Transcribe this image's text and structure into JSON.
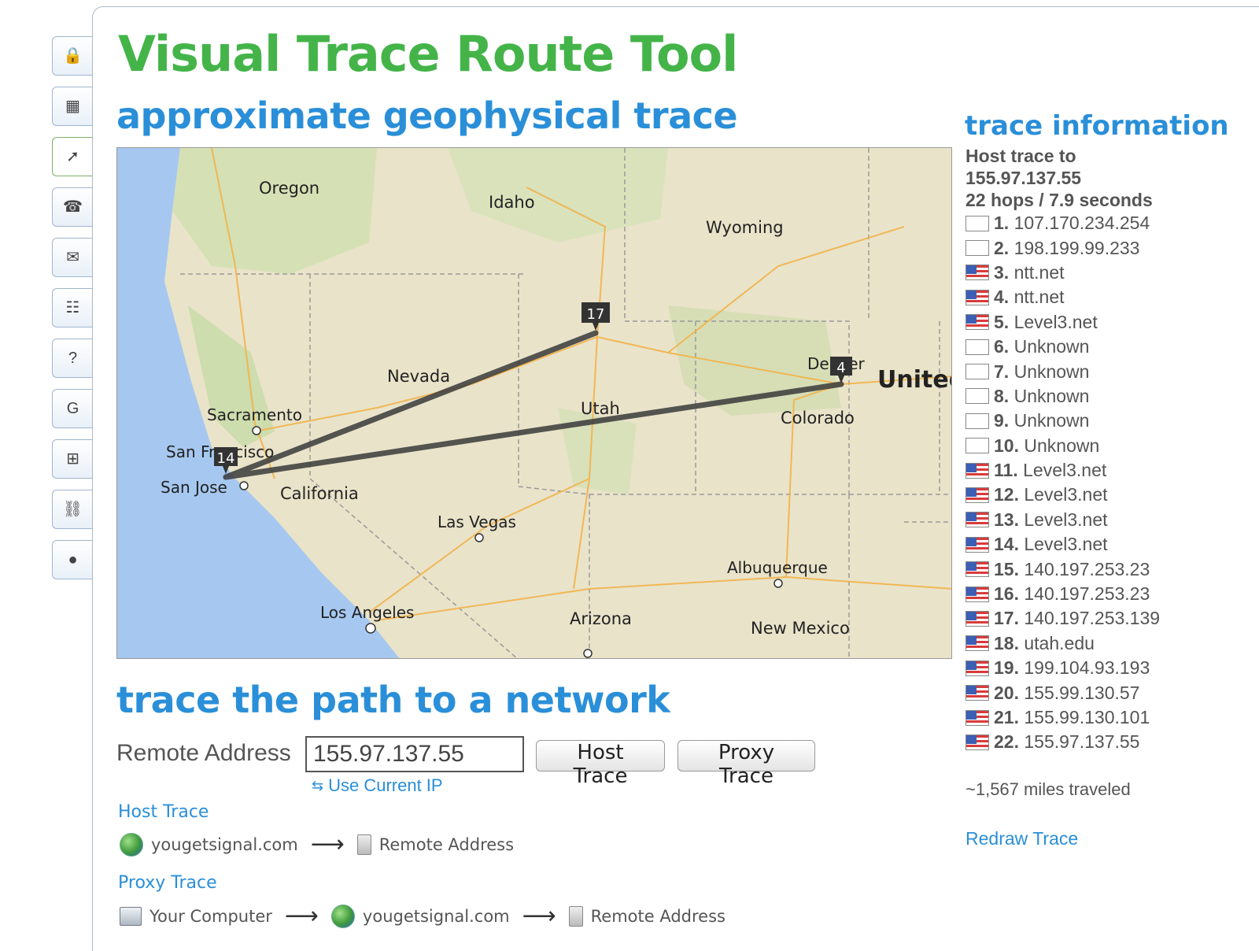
{
  "header": {
    "title": "Visual Trace Route Tool",
    "subtitle": "approximate geophysical trace"
  },
  "toolbar": {
    "items": [
      {
        "icon": "lock-icon",
        "glyph": "🔒"
      },
      {
        "icon": "map-icon",
        "glyph": "▦"
      },
      {
        "icon": "map-trace-icon",
        "glyph": "➚"
      },
      {
        "icon": "phone-icon",
        "glyph": "☎"
      },
      {
        "icon": "mail-icon",
        "glyph": "✉"
      },
      {
        "icon": "network-icon",
        "glyph": "☷"
      },
      {
        "icon": "help-icon",
        "glyph": "?"
      },
      {
        "icon": "google-icon",
        "glyph": "G"
      },
      {
        "icon": "windows-icon",
        "glyph": "⊞"
      },
      {
        "icon": "link-icon",
        "glyph": "⛓"
      },
      {
        "icon": "globe-icon",
        "glyph": "●"
      }
    ]
  },
  "map": {
    "states": [
      "Oregon",
      "Idaho",
      "Wyoming",
      "Nevada",
      "Utah",
      "Colorado",
      "California",
      "Arizona",
      "New Mexico"
    ],
    "cities": [
      "Sacramento",
      "San Francisco",
      "San Jose",
      "Las Vegas",
      "Los Angeles",
      "Albuquerque",
      "Denver"
    ],
    "country_label": "United",
    "markers": [
      "14",
      "17",
      "4"
    ]
  },
  "form": {
    "heading": "trace the path to a network",
    "remote_label": "Remote Address",
    "remote_value": "155.97.137.55",
    "host_trace_button": "Host Trace",
    "proxy_trace_button": "Proxy Trace",
    "use_current_ip": "Use Current IP"
  },
  "diagrams": {
    "host_title": "Host Trace",
    "proxy_title": "Proxy Trace",
    "site": "yougetsignal.com",
    "remote": "Remote Address",
    "your_computer": "Your Computer"
  },
  "trace_info": {
    "title": "trace information",
    "summary_line1": "Host trace to",
    "summary_line2": "155.97.137.55",
    "summary_line3": "22 hops / 7.9 seconds",
    "hops": [
      {
        "num": "1.",
        "host": " 107.170.234.254",
        "flag": "blank"
      },
      {
        "num": "2.",
        "host": " 198.199.99.233",
        "flag": "blank"
      },
      {
        "num": "3.",
        "host": " ntt.net",
        "flag": "us"
      },
      {
        "num": "4.",
        "host": " ntt.net",
        "flag": "us"
      },
      {
        "num": "5.",
        "host": " Level3.net",
        "flag": "us"
      },
      {
        "num": "6.",
        "host": " Unknown",
        "flag": "blank"
      },
      {
        "num": "7.",
        "host": " Unknown",
        "flag": "blank"
      },
      {
        "num": "8.",
        "host": " Unknown",
        "flag": "blank"
      },
      {
        "num": "9.",
        "host": " Unknown",
        "flag": "blank"
      },
      {
        "num": "10.",
        "host": " Unknown",
        "flag": "blank"
      },
      {
        "num": "11.",
        "host": " Level3.net",
        "flag": "us"
      },
      {
        "num": "12.",
        "host": " Level3.net",
        "flag": "us"
      },
      {
        "num": "13.",
        "host": " Level3.net",
        "flag": "us"
      },
      {
        "num": "14.",
        "host": " Level3.net",
        "flag": "us"
      },
      {
        "num": "15.",
        "host": " 140.197.253.23",
        "flag": "us"
      },
      {
        "num": "16.",
        "host": " 140.197.253.23",
        "flag": "us"
      },
      {
        "num": "17.",
        "host": " 140.197.253.139",
        "flag": "us"
      },
      {
        "num": "18.",
        "host": " utah.edu",
        "flag": "us"
      },
      {
        "num": "19.",
        "host": " 199.104.93.193",
        "flag": "us"
      },
      {
        "num": "20.",
        "host": " 155.99.130.57",
        "flag": "us"
      },
      {
        "num": "21.",
        "host": " 155.99.130.101",
        "flag": "us"
      },
      {
        "num": "22.",
        "host": " 155.97.137.55",
        "flag": "us"
      }
    ],
    "miles": "~1,567 miles traveled",
    "redraw": "Redraw Trace"
  },
  "colors": {
    "title_green": "#44b449",
    "accent_blue": "#2a8fd8",
    "route_line": "#3a3a3a"
  }
}
